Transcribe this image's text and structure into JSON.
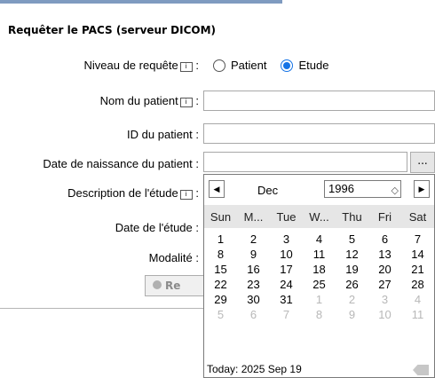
{
  "panel": {
    "title": "Requêter le PACS (serveur DICOM)"
  },
  "form": {
    "query_level_label": "Niveau de requête",
    "query_level_options": [
      "Patient",
      "Etude"
    ],
    "query_level_selected": "Etude",
    "patient_name_label": "Nom du patient",
    "patient_id_label": "ID du patient :",
    "birth_date_label": "Date de naissance du patient :",
    "study_description_label": "Description de l'étude",
    "study_date_label": "Date de l'étude :",
    "modality_label": "Modalité :",
    "colon": ":",
    "info_icon_glyph": "i",
    "ellipsis_label": "...",
    "query_button_label": "Re"
  },
  "calendar": {
    "month": "Dec",
    "year": "1996",
    "prev_glyph": "◀",
    "next_glyph": "▶",
    "spin_glyph": "◇",
    "weekdays": [
      "Sun",
      "M...",
      "Tue",
      "W...",
      "Thu",
      "Fri",
      "Sat"
    ],
    "weeks": [
      [
        "1",
        "2",
        "3",
        "4",
        "5",
        "6",
        "7"
      ],
      [
        "8",
        "9",
        "10",
        "11",
        "12",
        "13",
        "14"
      ],
      [
        "15",
        "16",
        "17",
        "18",
        "19",
        "20",
        "21"
      ],
      [
        "22",
        "23",
        "24",
        "25",
        "26",
        "27",
        "28"
      ],
      [
        "29",
        "30",
        "31",
        "1",
        "2",
        "3",
        "4"
      ],
      [
        "5",
        "6",
        "7",
        "8",
        "9",
        "10",
        "11"
      ]
    ],
    "today_label": "Today: 2025 Sep 19"
  }
}
